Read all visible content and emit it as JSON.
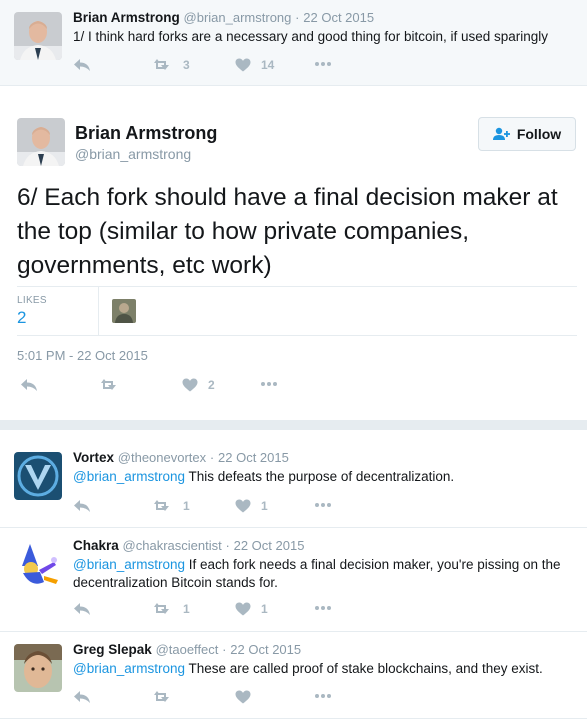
{
  "parent_tweet": {
    "name": "Brian Armstrong",
    "handle": "@brian_armstrong",
    "sep": "·",
    "date": "22 Oct 2015",
    "text": "1/ I think hard forks are a necessary and good thing for bitcoin, if used sparingly",
    "retweets": "3",
    "likes": "14"
  },
  "main_tweet": {
    "name": "Brian Armstrong",
    "handle": "@brian_armstrong",
    "follow_label": "Follow",
    "text": "6/ Each fork should have a final decision maker at the top (similar to how private companies, governments, etc work)",
    "likes_label": "LIKES",
    "likes_count": "2",
    "timestamp": "5:01 PM - 22 Oct 2015",
    "action_likes": "2"
  },
  "replies": [
    {
      "name": "Vortex",
      "handle": "@theonevortex",
      "sep": "·",
      "date": "22 Oct 2015",
      "mention": "@brian_armstrong",
      "text": " This defeats the purpose of decentralization.",
      "retweets": "1",
      "likes": "1"
    },
    {
      "name": "Chakra",
      "handle": "@chakrascientist",
      "sep": "·",
      "date": "22 Oct 2015",
      "mention": "@brian_armstrong",
      "text": " If each fork needs a final decision maker, you're pissing on the decentralization Bitcoin stands for.",
      "retweets": "1",
      "likes": "1"
    },
    {
      "name": "Greg Slepak",
      "handle": "@taoeffect",
      "sep": "·",
      "date": "22 Oct 2015",
      "mention": "@brian_armstrong",
      "text": " These are called proof of stake blockchains, and they exist."
    }
  ],
  "icons": {
    "reply": "reply-icon",
    "retweet": "retweet-icon",
    "like": "heart-icon",
    "more": "more-icon",
    "follow": "add-user-icon"
  },
  "colors": {
    "link": "#1b95e0",
    "muted": "#8899a6",
    "icon": "#aab8c2",
    "vortex_avatar": "#1b4f72"
  }
}
